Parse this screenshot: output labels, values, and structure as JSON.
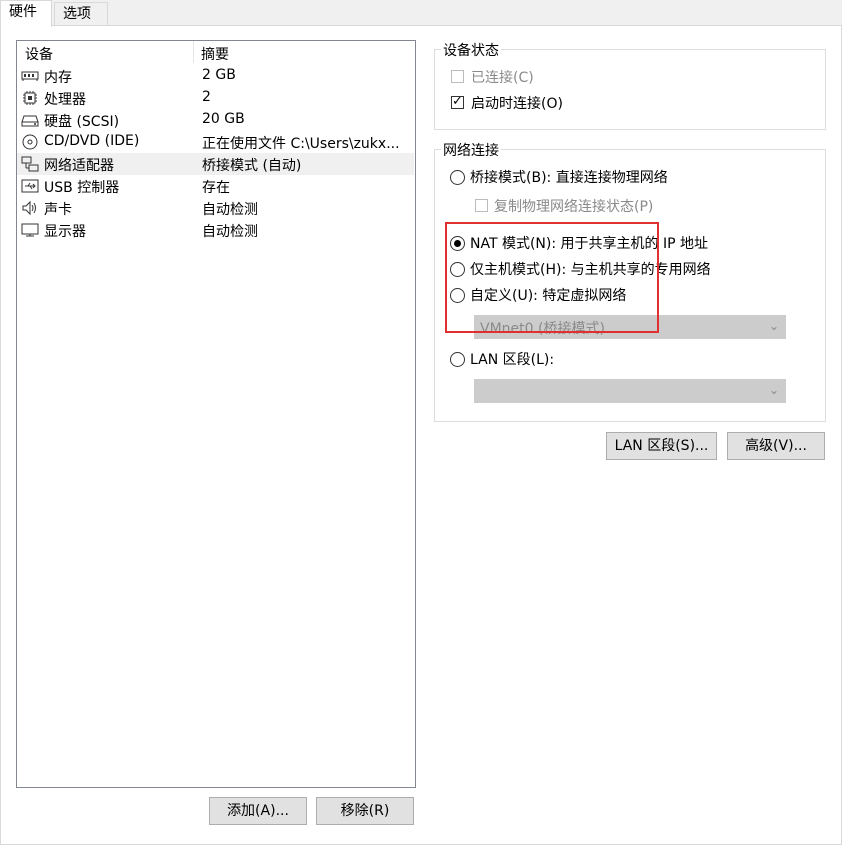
{
  "tabs": [
    {
      "label": "硬件",
      "active": true
    },
    {
      "label": "选项",
      "active": false
    }
  ],
  "device_list": {
    "headers": {
      "device": "设备",
      "summary": "摘要"
    },
    "rows": [
      {
        "icon": "memory-icon",
        "device": "内存",
        "summary": "2 GB",
        "selected": false
      },
      {
        "icon": "processor-icon",
        "device": "处理器",
        "summary": "2",
        "selected": false
      },
      {
        "icon": "hard-disk-icon",
        "device": "硬盘 (SCSI)",
        "summary": "20 GB",
        "selected": false
      },
      {
        "icon": "cd-dvd-icon",
        "device": "CD/DVD (IDE)",
        "summary": "正在使用文件 C:\\Users\\zukx...",
        "selected": false
      },
      {
        "icon": "network-adapter-icon",
        "device": "网络适配器",
        "summary": "桥接模式 (自动)",
        "selected": true
      },
      {
        "icon": "usb-icon",
        "device": "USB 控制器",
        "summary": "存在",
        "selected": false
      },
      {
        "icon": "sound-card-icon",
        "device": "声卡",
        "summary": "自动检测",
        "selected": false
      },
      {
        "icon": "display-icon",
        "device": "显示器",
        "summary": "自动检测",
        "selected": false
      }
    ]
  },
  "list_buttons": {
    "add": "添加(A)...",
    "remove": "移除(R)"
  },
  "device_status": {
    "title": "设备状态",
    "connected": {
      "label": "已连接(C)",
      "checked": false,
      "enabled": false
    },
    "connect_at_power_on": {
      "label": "启动时连接(O)",
      "checked": true,
      "enabled": true
    }
  },
  "network_connection": {
    "title": "网络连接",
    "options": {
      "bridged": {
        "label": "桥接模式(B): 直接连接物理网络",
        "selected": false
      },
      "replicate": {
        "label": "复制物理网络连接状态(P)",
        "checked": false,
        "enabled": false
      },
      "nat": {
        "label": "NAT 模式(N): 用于共享主机的 IP 地址",
        "selected": true
      },
      "host_only": {
        "label": "仅主机模式(H): 与主机共享的专用网络",
        "selected": false
      },
      "custom": {
        "label": "自定义(U): 特定虚拟网络",
        "selected": false
      },
      "custom_select_value": "VMnet0 (桥接模式)",
      "lan_segment": {
        "label": "LAN 区段(L):",
        "selected": false
      },
      "lan_select_value": ""
    }
  },
  "bottom_buttons": {
    "lan_segments": "LAN 区段(S)...",
    "advanced": "高级(V)..."
  },
  "annotation_color": "#e03030"
}
